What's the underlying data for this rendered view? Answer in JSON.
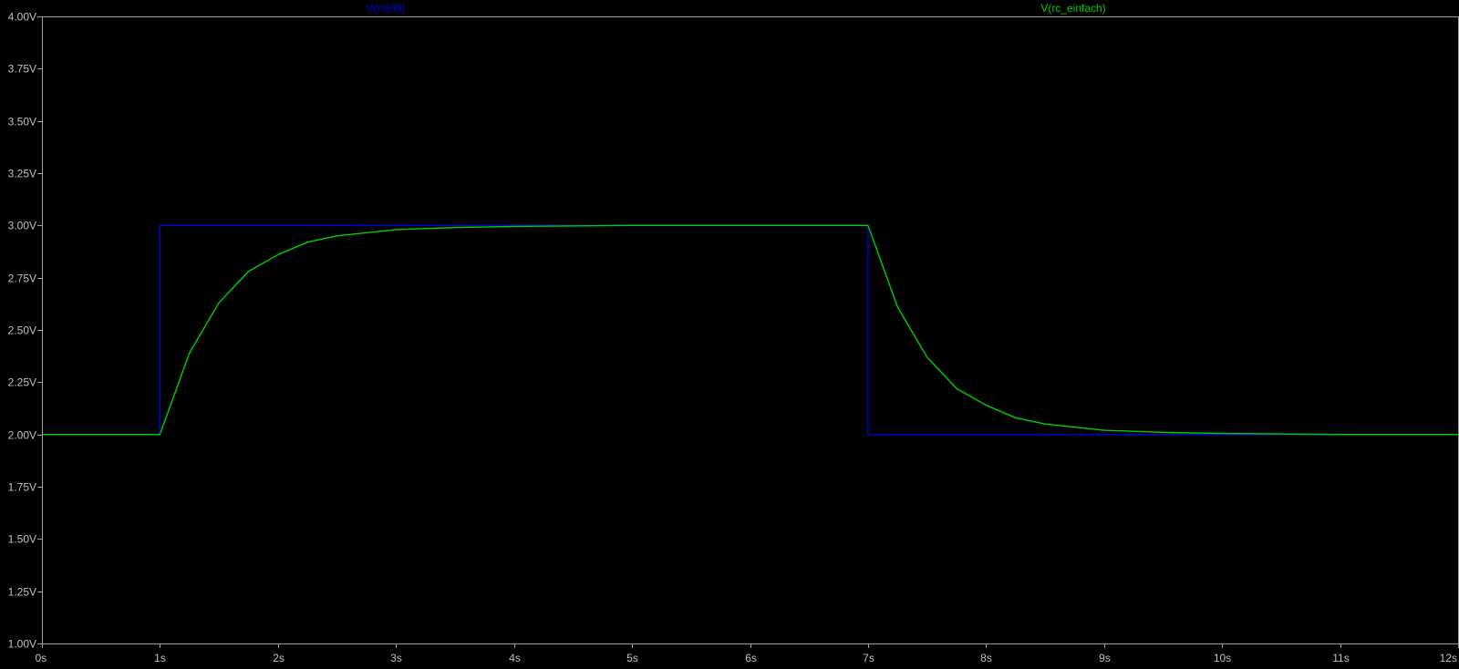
{
  "colors": {
    "background": "#000000",
    "frame": "#a0a0a0",
    "tick_text": "#c0c0c0"
  },
  "chart_data": {
    "type": "line",
    "xlabel": "",
    "ylabel": "",
    "xlim": [
      0,
      12
    ],
    "ylim": [
      1.0,
      4.0
    ],
    "grid": false,
    "legend_position": "top",
    "x_ticks": [
      "0s",
      "1s",
      "2s",
      "3s",
      "4s",
      "5s",
      "6s",
      "7s",
      "8s",
      "9s",
      "10s",
      "11s",
      "12s"
    ],
    "y_ticks": [
      "1.00V",
      "1.25V",
      "1.50V",
      "1.75V",
      "2.00V",
      "2.25V",
      "2.50V",
      "2.75V",
      "3.00V",
      "3.25V",
      "3.50V",
      "3.75V",
      "4.00V"
    ],
    "series": [
      {
        "name": "V(n009)",
        "color": "#0000e0",
        "x": [
          0,
          1,
          1,
          7,
          7,
          12
        ],
        "y": [
          2.0,
          2.0,
          3.0,
          3.0,
          2.0,
          2.0
        ]
      },
      {
        "name": "V(rc_einfach)",
        "color": "#00d000",
        "x": [
          0,
          1,
          1.25,
          1.5,
          1.75,
          2,
          2.25,
          2.5,
          3,
          3.5,
          4,
          5,
          6,
          7,
          7.25,
          7.5,
          7.75,
          8,
          8.25,
          8.5,
          9,
          9.5,
          10,
          11,
          12
        ],
        "y": [
          2.0,
          2.0,
          2.39,
          2.63,
          2.78,
          2.86,
          2.92,
          2.95,
          2.98,
          2.99,
          2.995,
          3.0,
          3.0,
          3.0,
          2.61,
          2.37,
          2.22,
          2.14,
          2.08,
          2.05,
          2.02,
          2.01,
          2.005,
          2.0,
          2.0
        ]
      }
    ]
  }
}
